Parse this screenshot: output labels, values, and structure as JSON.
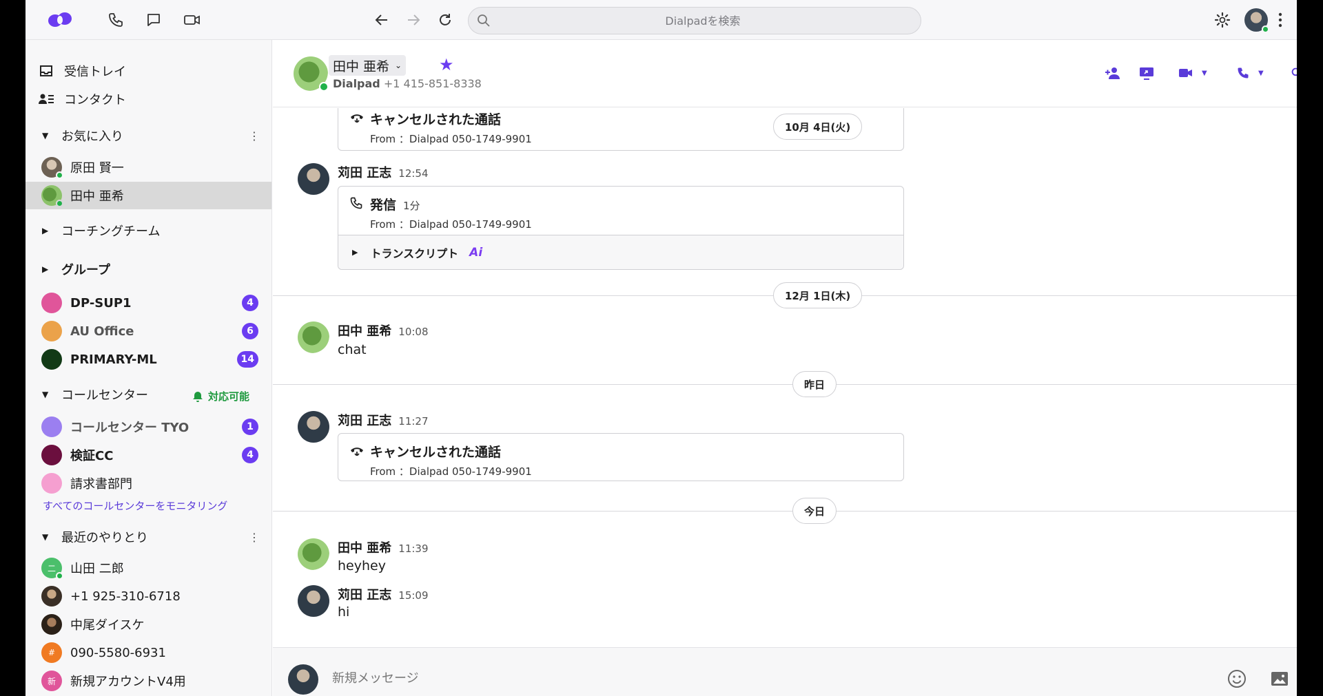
{
  "colors": {
    "accent": "#6b3cf1",
    "online": "#20b14a",
    "available": "#1f9a3f",
    "sidebar_active": "#d9d9d9"
  },
  "topbar": {
    "search_placeholder": "Dialpadを検索",
    "icons": [
      "dialpad-logo",
      "phone-icon",
      "chat-icon",
      "video-icon",
      "back-icon",
      "forward-icon",
      "reload-icon",
      "settings-icon",
      "more-vertical-icon"
    ]
  },
  "sidebar": {
    "inbox": "受信トレイ",
    "contacts": "コンタクト",
    "favorites": {
      "title": "お気に入り",
      "items": [
        {
          "name": "原田 賢一",
          "online": true
        },
        {
          "name": "田中 亜希",
          "online": true,
          "active": true
        }
      ]
    },
    "coaching_team": "コーチングチーム",
    "groups": {
      "title": "グループ",
      "items": [
        {
          "name": "DP-SUP1",
          "badge": "4",
          "color": "#e0559a"
        },
        {
          "name": "AU Office",
          "badge": "6",
          "color": "#eba24a"
        },
        {
          "name": "PRIMARY-ML",
          "badge": "14",
          "color": "#123a16"
        }
      ]
    },
    "call_center": {
      "title": "コールセンター",
      "status": "対応可能",
      "items": [
        {
          "name": "コールセンター TYO",
          "badge": "1",
          "color": "#9b7ff0"
        },
        {
          "name": "検証CC",
          "badge": "4",
          "color": "#6b0f3e"
        },
        {
          "name": "請求書部門",
          "badge": "",
          "color": "#f59fd0"
        }
      ],
      "monitor_link": "すべてのコールセンターをモニタリング"
    },
    "recent": {
      "title": "最近のやりとり",
      "items": [
        {
          "name": "山田 二郎",
          "avatar_text": "二",
          "color": "#4bbf6b"
        },
        {
          "name": "+1 925-310-6718",
          "avatar_text": "",
          "color": "#7a6a5a"
        },
        {
          "name": "中尾ダイスケ",
          "avatar_text": "",
          "color": "#5a4a3a"
        },
        {
          "name": "090-5580-6931",
          "avatar_text": "#",
          "color": "#f07a22"
        },
        {
          "name": "新規アカウントV4用",
          "avatar_text": "新",
          "color": "#e0559a"
        }
      ]
    }
  },
  "header": {
    "contact_name": "田中 亜希",
    "company": "Dialpad",
    "phone": "+1 415-851-8338"
  },
  "messages": {
    "card1": {
      "title": "キャンセルされた通話",
      "from": "From ：Dialpad 050-1749-9901",
      "date": "10月 4日(火)"
    },
    "msg1": {
      "sender": "苅田 正志",
      "time": "12:54",
      "call_title": "発信",
      "duration": "1分",
      "from": "From ：Dialpad 050-1749-9901",
      "transcript": "トランスクリプト",
      "ai": "Ai"
    },
    "date2": "12月 1日(木)",
    "msg2": {
      "sender": "田中 亜希",
      "time": "10:08",
      "text": "chat"
    },
    "date3": "昨日",
    "msg3": {
      "sender": "苅田 正志",
      "time": "11:27",
      "call_title": "キャンセルされた通話",
      "from": "From ：Dialpad 050-1749-9901"
    },
    "date4": "今日",
    "msg4": {
      "sender": "田中 亜希",
      "time": "11:39",
      "text": "heyhey"
    },
    "msg5": {
      "sender": "苅田 正志",
      "time": "15:09",
      "text": "hi"
    }
  },
  "composer": {
    "placeholder": "新規メッセージ"
  }
}
